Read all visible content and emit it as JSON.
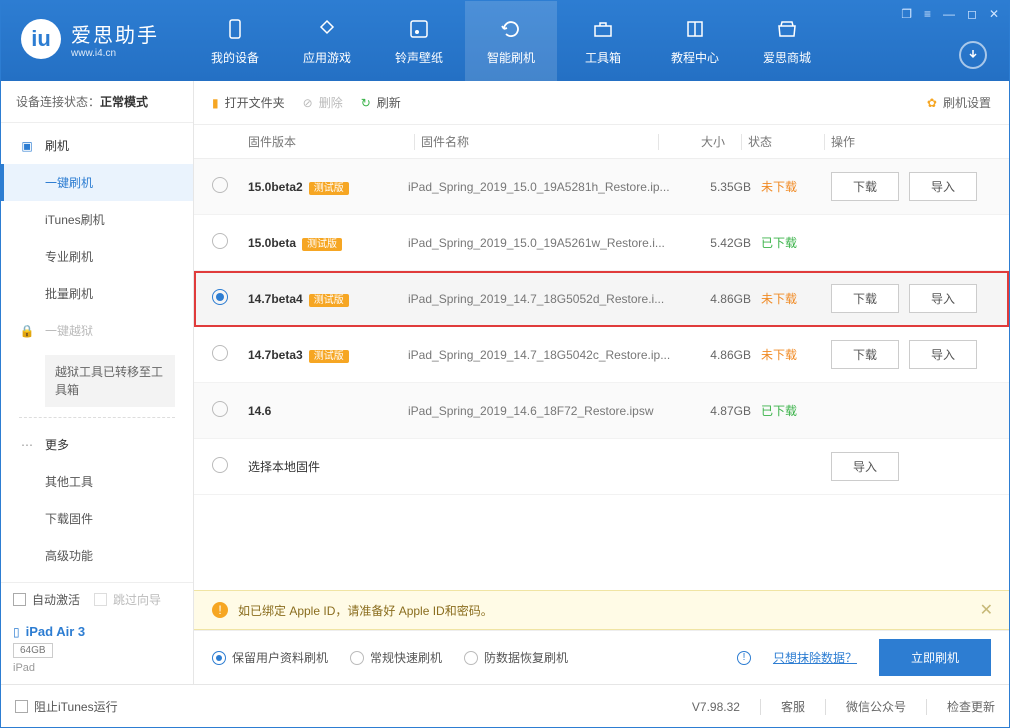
{
  "window_controls": [
    "❐",
    "≡",
    "—",
    "◻",
    "✕"
  ],
  "logo": {
    "title": "爱思助手",
    "subtitle": "www.i4.cn"
  },
  "nav": [
    {
      "label": "我的设备",
      "icon": "phone"
    },
    {
      "label": "应用游戏",
      "icon": "apps"
    },
    {
      "label": "铃声壁纸",
      "icon": "music"
    },
    {
      "label": "智能刷机",
      "icon": "refresh",
      "active": true
    },
    {
      "label": "工具箱",
      "icon": "toolbox"
    },
    {
      "label": "教程中心",
      "icon": "book"
    },
    {
      "label": "爱思商城",
      "icon": "store"
    }
  ],
  "sidebar": {
    "conn_label": "设备连接状态：",
    "conn_value": "正常模式",
    "flash_title": "刷机",
    "items": [
      "一键刷机",
      "iTunes刷机",
      "专业刷机",
      "批量刷机"
    ],
    "active_item": 0,
    "jailbreak_title": "一键越狱",
    "jailbreak_note": "越狱工具已转移至工具箱",
    "more_title": "更多",
    "more_items": [
      "其他工具",
      "下载固件",
      "高级功能"
    ],
    "auto_activate": "自动激活",
    "skip_guide": "跳过向导",
    "device": {
      "name": "iPad Air 3",
      "capacity": "64GB",
      "type": "iPad"
    }
  },
  "toolbar": {
    "open": "打开文件夹",
    "delete": "删除",
    "refresh": "刷新",
    "settings": "刷机设置"
  },
  "table": {
    "head": {
      "version": "固件版本",
      "name": "固件名称",
      "size": "大小",
      "status": "状态",
      "ops": "操作"
    },
    "status_labels": {
      "no": "未下载",
      "yes": "已下载"
    },
    "btn_labels": {
      "download": "下载",
      "import": "导入"
    },
    "beta_label": "测试版",
    "local_row": "选择本地固件",
    "rows": [
      {
        "version": "15.0beta2",
        "beta": true,
        "name": "iPad_Spring_2019_15.0_19A5281h_Restore.ip...",
        "size": "5.35GB",
        "status": "no",
        "ops": [
          "download",
          "import"
        ],
        "selected": false,
        "alt": true
      },
      {
        "version": "15.0beta",
        "beta": true,
        "name": "iPad_Spring_2019_15.0_19A5261w_Restore.i...",
        "size": "5.42GB",
        "status": "yes",
        "ops": [],
        "selected": false,
        "alt": false
      },
      {
        "version": "14.7beta4",
        "beta": true,
        "name": "iPad_Spring_2019_14.7_18G5052d_Restore.i...",
        "size": "4.86GB",
        "status": "no",
        "ops": [
          "download",
          "import"
        ],
        "selected": true,
        "alt": true
      },
      {
        "version": "14.7beta3",
        "beta": true,
        "name": "iPad_Spring_2019_14.7_18G5042c_Restore.ip...",
        "size": "4.86GB",
        "status": "no",
        "ops": [
          "download",
          "import"
        ],
        "selected": false,
        "alt": false
      },
      {
        "version": "14.6",
        "beta": false,
        "name": "iPad_Spring_2019_14.6_18F72_Restore.ipsw",
        "size": "4.87GB",
        "status": "yes",
        "ops": [],
        "selected": false,
        "alt": true
      }
    ]
  },
  "notice": "如已绑定 Apple ID，请准备好 Apple ID和密码。",
  "action": {
    "options": [
      "保留用户资料刷机",
      "常规快速刷机",
      "防数据恢复刷机"
    ],
    "selected": 0,
    "erase_link": "只想抹除数据？",
    "flash_btn": "立即刷机"
  },
  "footer": {
    "block_itunes": "阻止iTunes运行",
    "version": "V7.98.32",
    "service": "客服",
    "wechat": "微信公众号",
    "update": "检查更新"
  }
}
